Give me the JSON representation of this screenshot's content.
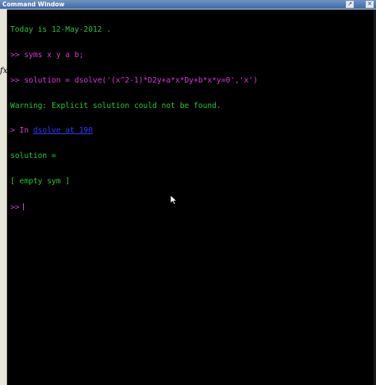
{
  "window": {
    "title": "Command Window"
  },
  "titlebar": {
    "undock_icon": "undock-arrow-icon",
    "close_icon": "close-x-icon",
    "undock_glyph": "↗",
    "close_glyph": "✕"
  },
  "gutter": {
    "fx_label": "fx"
  },
  "console": {
    "line1": "Today is 12-May-2012 .",
    "line2": ">> syms x y a b;",
    "line3": ">> solution = dsolve('(x^2-1)*D2y+a*x*Dy+b*x*y=0','x')",
    "line4": "Warning: Explicit solution could not be found.",
    "line5_prefix": "> In ",
    "line5_link": "dsolve at 190",
    "line6": "solution =",
    "line7": "[ empty sym ]",
    "prompt": ">>"
  },
  "colors": {
    "background": "#000000",
    "output_text": "#22c63b",
    "command_text": "#d23bd2",
    "link_text": "#2f3bff",
    "titlebar": "#3d6aa8"
  }
}
